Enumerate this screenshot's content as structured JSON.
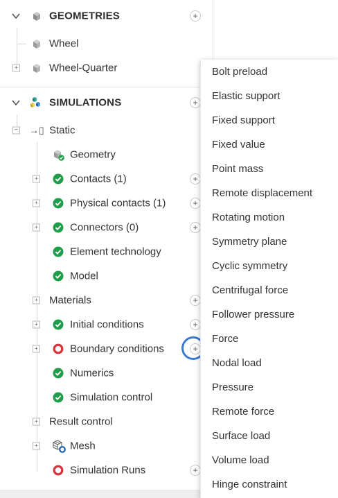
{
  "geometries": {
    "header": "GEOMETRIES",
    "items": [
      {
        "label": "Wheel"
      },
      {
        "label": "Wheel-Quarter"
      }
    ]
  },
  "simulations": {
    "header": "SIMULATIONS",
    "static": {
      "label": "Static"
    },
    "items": [
      {
        "label": "Geometry",
        "status": "geometry-ok"
      },
      {
        "label": "Contacts (1)",
        "status": "ok"
      },
      {
        "label": "Physical contacts (1)",
        "status": "ok"
      },
      {
        "label": "Connectors (0)",
        "status": "ok"
      },
      {
        "label": "Element technology",
        "status": "ok"
      },
      {
        "label": "Model",
        "status": "ok"
      },
      {
        "label": "Materials",
        "status": "none"
      },
      {
        "label": "Initial conditions",
        "status": "ok"
      },
      {
        "label": "Boundary conditions",
        "status": "error"
      },
      {
        "label": "Numerics",
        "status": "ok"
      },
      {
        "label": "Simulation control",
        "status": "ok"
      },
      {
        "label": "Result control",
        "status": "none"
      },
      {
        "label": "Mesh",
        "status": "mesh"
      },
      {
        "label": "Simulation Runs",
        "status": "error"
      }
    ]
  },
  "boundary_menu": {
    "items": [
      "Bolt preload",
      "Elastic support",
      "Fixed support",
      "Fixed value",
      "Point mass",
      "Remote displacement",
      "Rotating motion",
      "Symmetry plane",
      "Cyclic symmetry",
      "Centrifugal force",
      "Follower pressure",
      "Force",
      "Nodal load",
      "Pressure",
      "Remote force",
      "Surface load",
      "Volume load",
      "Hinge constraint"
    ]
  },
  "colors": {
    "ok_green": "#1e9e4a",
    "error_red": "#d9303a",
    "highlight_blue": "#3a78d6"
  },
  "icons": {
    "collapse": "chevron-down-icon",
    "expand": "plus-square-icon",
    "add": "add-circle-icon",
    "geometry": "cube-icon",
    "simulation": "simulation-cubes-icon",
    "status_ok": "check-circle-icon",
    "status_error": "error-ring-icon",
    "mesh": "mesh-icon"
  }
}
